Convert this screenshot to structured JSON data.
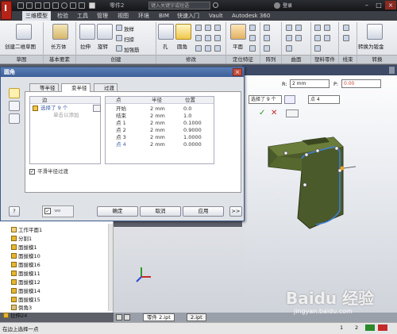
{
  "app": {
    "doc_title": "零件2",
    "search_placeholder": "键入关键字或短语",
    "login": "登录"
  },
  "menu_tabs": [
    "三维模型",
    "检验",
    "工具",
    "管理",
    "视图",
    "环境",
    "BIM",
    "快速入门",
    "Vault",
    "Autodesk 360"
  ],
  "ribbon": {
    "create_sketch": "创建二维草图",
    "sketch_group": "草图",
    "box": "长方体",
    "primitives_group": "基本要素",
    "extrude": "拉伸",
    "revolve": "旋转",
    "loft": "放样",
    "sweep": "扫掠",
    "rib": "加强筋",
    "create_group": "创建",
    "hole": "孔",
    "fillet": "圆角",
    "modify_group": "修改",
    "plane": "平面",
    "work_features_group": "定位特征",
    "pattern_group": "阵列",
    "surface_group": "曲面",
    "plastic_group": "塑料零件",
    "harness_group": "线束",
    "convert_sheetmetal": "转换为钣金",
    "convert_group": "转换"
  },
  "viewport_toolbar": {
    "radius_label": "R:",
    "radius_value": "2 mm",
    "p_label": "P:",
    "p_value": "0.00",
    "select_value": "选择了 9 个",
    "point_value": "点 4"
  },
  "dialog": {
    "title": "圆角",
    "tabs": [
      "等半径",
      "变半径",
      "过渡"
    ],
    "edge_header": "边",
    "edge_selected": "选择了 9 个",
    "edge_add": "单击以添加",
    "cols": [
      "点",
      "半径",
      "位置"
    ],
    "rows": [
      {
        "point": "开始",
        "radius": "2 mm",
        "position": "0.0"
      },
      {
        "point": "结束",
        "radius": "2 mm",
        "position": "1.0"
      },
      {
        "point": "点 1",
        "radius": "2 mm",
        "position": "0.1000"
      },
      {
        "point": "点 2",
        "radius": "2 mm",
        "position": "0.9000"
      },
      {
        "point": "点 3",
        "radius": "2 mm",
        "position": "1.0000"
      },
      {
        "point": "点 4",
        "radius": "2 mm",
        "position": "0.0000"
      }
    ],
    "smooth_label": "平滑半径过渡",
    "ok": "确定",
    "cancel": "取消",
    "apply": "应用",
    "more": ">>",
    "help": "?"
  },
  "browser": {
    "items": [
      "工作平面1",
      "分割1",
      "面拔模1",
      "面拔模10",
      "面拔模16",
      "面拔模11",
      "面拔模12",
      "面拔模14",
      "面拔模15",
      "倒角3",
      "拉伸24"
    ]
  },
  "doc_tabs": [
    "零件 2.ipt",
    "2.ipt"
  ],
  "status": {
    "text": "在边上选择一点",
    "num1": "1",
    "num2": "2"
  },
  "watermark": {
    "brand": "Baidu 经验",
    "url": "jingyan.baidu.com"
  },
  "colors": {
    "part_body": "#4a5a2a",
    "selection_edge": "#3f7fd6",
    "dialog_title": "#3d5f98",
    "app_icon": "#b52418"
  }
}
